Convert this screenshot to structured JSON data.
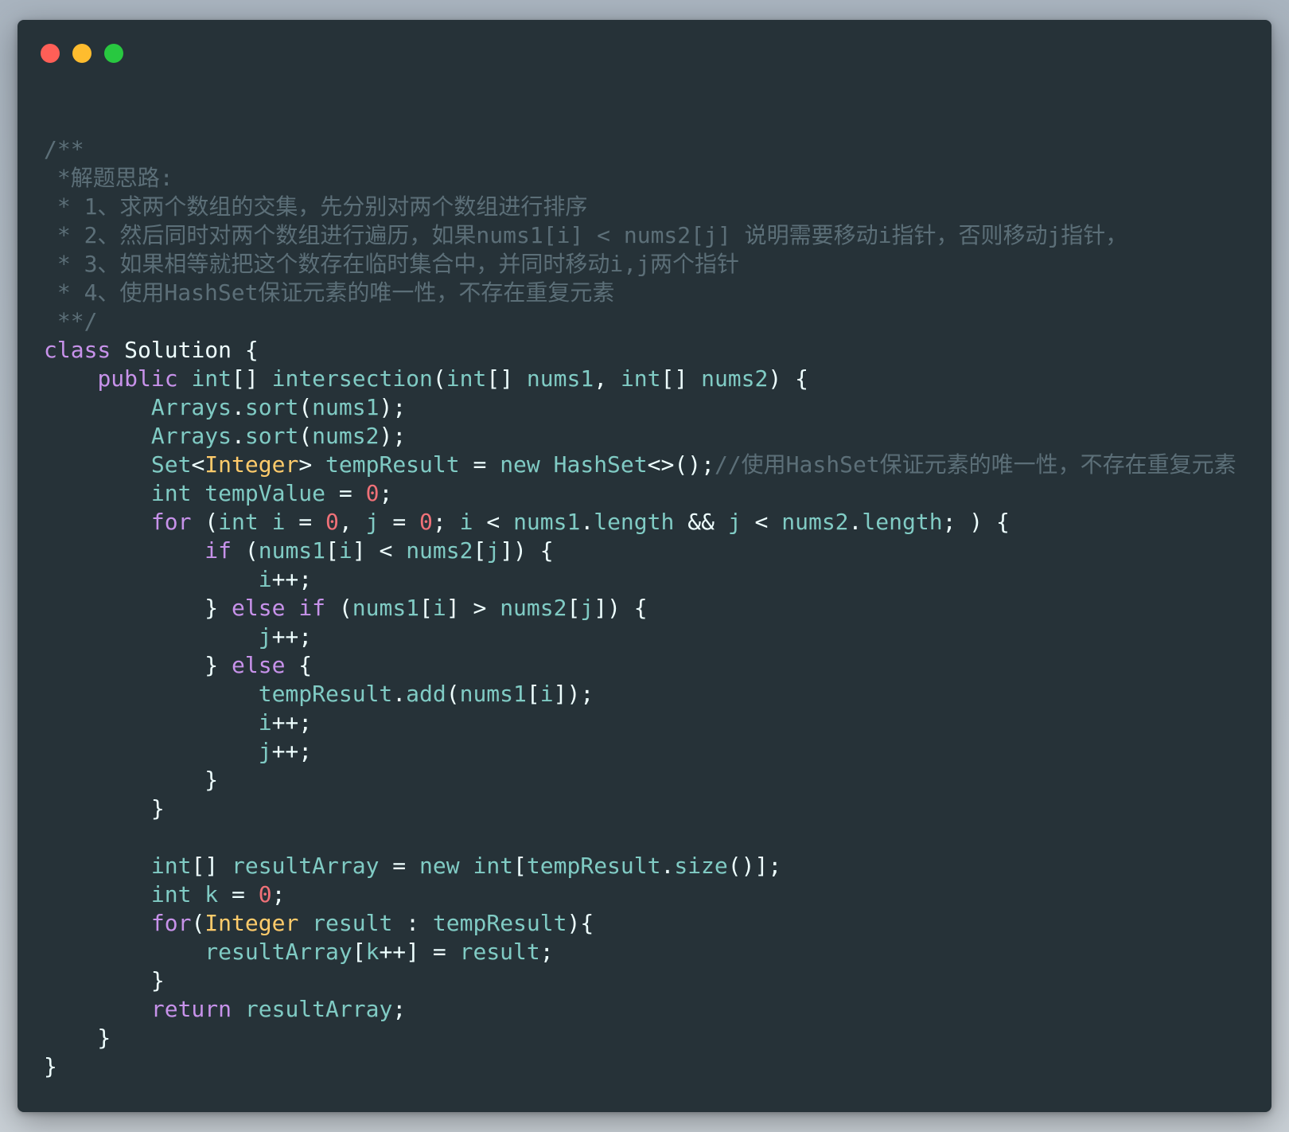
{
  "window": {
    "traffic_lights": [
      {
        "name": "close",
        "color": "#ff5f57"
      },
      {
        "name": "minimize",
        "color": "#febc2e"
      },
      {
        "name": "maximize",
        "color": "#28c840"
      }
    ]
  },
  "colors": {
    "background": "#263238",
    "comment": "#5c6f78",
    "keyword": "#c792ea",
    "identifier": "#80cbc4",
    "number": "#f07178",
    "class": "#ffcb6b",
    "plain": "#eeffff"
  },
  "code": {
    "language": "java",
    "lines": [
      [
        [
          "comment",
          "/**"
        ]
      ],
      [
        [
          "comment",
          " *解题思路:"
        ]
      ],
      [
        [
          "comment",
          " * 1、求两个数组的交集，先分别对两个数组进行排序"
        ]
      ],
      [
        [
          "comment",
          " * 2、然后同时对两个数组进行遍历，如果nums1[i] < nums2[j] 说明需要移动i指针，否则移动j指针，"
        ]
      ],
      [
        [
          "comment",
          " * 3、如果相等就把这个数存在临时集合中，并同时移动i,j两个指针"
        ]
      ],
      [
        [
          "comment",
          " * 4、使用HashSet保证元素的唯一性，不存在重复元素"
        ]
      ],
      [
        [
          "comment",
          " **/"
        ]
      ],
      [
        [
          "keyword",
          "class"
        ],
        [
          "plain",
          " Solution {"
        ]
      ],
      [
        [
          "plain",
          "    "
        ],
        [
          "keyword",
          "public"
        ],
        [
          "plain",
          " "
        ],
        [
          "type",
          "int"
        ],
        [
          "plain",
          "[] "
        ],
        [
          "ident",
          "intersection"
        ],
        [
          "plain",
          "("
        ],
        [
          "type",
          "int"
        ],
        [
          "plain",
          "[] "
        ],
        [
          "ident",
          "nums1"
        ],
        [
          "plain",
          ", "
        ],
        [
          "type",
          "int"
        ],
        [
          "plain",
          "[] "
        ],
        [
          "ident",
          "nums2"
        ],
        [
          "plain",
          ") {"
        ]
      ],
      [
        [
          "plain",
          "        "
        ],
        [
          "ident",
          "Arrays"
        ],
        [
          "plain",
          "."
        ],
        [
          "ident",
          "sort"
        ],
        [
          "plain",
          "("
        ],
        [
          "ident",
          "nums1"
        ],
        [
          "plain",
          ");"
        ]
      ],
      [
        [
          "plain",
          "        "
        ],
        [
          "ident",
          "Arrays"
        ],
        [
          "plain",
          "."
        ],
        [
          "ident",
          "sort"
        ],
        [
          "plain",
          "("
        ],
        [
          "ident",
          "nums2"
        ],
        [
          "plain",
          ");"
        ]
      ],
      [
        [
          "plain",
          "        "
        ],
        [
          "ident",
          "Set"
        ],
        [
          "plain",
          "<"
        ],
        [
          "class",
          "Integer"
        ],
        [
          "plain",
          "> "
        ],
        [
          "ident",
          "tempResult"
        ],
        [
          "plain",
          " = "
        ],
        [
          "ident",
          "new"
        ],
        [
          "plain",
          " "
        ],
        [
          "ident",
          "HashSet"
        ],
        [
          "plain",
          "<>();"
        ],
        [
          "comment",
          "//使用HashSet保证元素的唯一性，不存在重复元素"
        ]
      ],
      [
        [
          "plain",
          "        "
        ],
        [
          "type",
          "int"
        ],
        [
          "plain",
          " "
        ],
        [
          "ident",
          "tempValue"
        ],
        [
          "plain",
          " = "
        ],
        [
          "number",
          "0"
        ],
        [
          "plain",
          ";"
        ]
      ],
      [
        [
          "plain",
          "        "
        ],
        [
          "keyword",
          "for"
        ],
        [
          "plain",
          " ("
        ],
        [
          "type",
          "int"
        ],
        [
          "plain",
          " "
        ],
        [
          "ident",
          "i"
        ],
        [
          "plain",
          " = "
        ],
        [
          "number",
          "0"
        ],
        [
          "plain",
          ", "
        ],
        [
          "ident",
          "j"
        ],
        [
          "plain",
          " = "
        ],
        [
          "number",
          "0"
        ],
        [
          "plain",
          "; "
        ],
        [
          "ident",
          "i"
        ],
        [
          "plain",
          " < "
        ],
        [
          "ident",
          "nums1"
        ],
        [
          "plain",
          "."
        ],
        [
          "ident",
          "length"
        ],
        [
          "plain",
          " && "
        ],
        [
          "ident",
          "j"
        ],
        [
          "plain",
          " < "
        ],
        [
          "ident",
          "nums2"
        ],
        [
          "plain",
          "."
        ],
        [
          "ident",
          "length"
        ],
        [
          "plain",
          "; ) {"
        ]
      ],
      [
        [
          "plain",
          "            "
        ],
        [
          "keyword",
          "if"
        ],
        [
          "plain",
          " ("
        ],
        [
          "ident",
          "nums1"
        ],
        [
          "plain",
          "["
        ],
        [
          "ident",
          "i"
        ],
        [
          "plain",
          "] < "
        ],
        [
          "ident",
          "nums2"
        ],
        [
          "plain",
          "["
        ],
        [
          "ident",
          "j"
        ],
        [
          "plain",
          "]) {"
        ]
      ],
      [
        [
          "plain",
          "                "
        ],
        [
          "ident",
          "i"
        ],
        [
          "plain",
          "++;"
        ]
      ],
      [
        [
          "plain",
          "            } "
        ],
        [
          "keyword",
          "else"
        ],
        [
          "plain",
          " "
        ],
        [
          "keyword",
          "if"
        ],
        [
          "plain",
          " ("
        ],
        [
          "ident",
          "nums1"
        ],
        [
          "plain",
          "["
        ],
        [
          "ident",
          "i"
        ],
        [
          "plain",
          "] > "
        ],
        [
          "ident",
          "nums2"
        ],
        [
          "plain",
          "["
        ],
        [
          "ident",
          "j"
        ],
        [
          "plain",
          "]) {"
        ]
      ],
      [
        [
          "plain",
          "                "
        ],
        [
          "ident",
          "j"
        ],
        [
          "plain",
          "++;"
        ]
      ],
      [
        [
          "plain",
          "            } "
        ],
        [
          "keyword",
          "else"
        ],
        [
          "plain",
          " {"
        ]
      ],
      [
        [
          "plain",
          "                "
        ],
        [
          "ident",
          "tempResult"
        ],
        [
          "plain",
          "."
        ],
        [
          "ident",
          "add"
        ],
        [
          "plain",
          "("
        ],
        [
          "ident",
          "nums1"
        ],
        [
          "plain",
          "["
        ],
        [
          "ident",
          "i"
        ],
        [
          "plain",
          "]);"
        ]
      ],
      [
        [
          "plain",
          "                "
        ],
        [
          "ident",
          "i"
        ],
        [
          "plain",
          "++;"
        ]
      ],
      [
        [
          "plain",
          "                "
        ],
        [
          "ident",
          "j"
        ],
        [
          "plain",
          "++;"
        ]
      ],
      [
        [
          "plain",
          "            }"
        ]
      ],
      [
        [
          "plain",
          "        }"
        ]
      ],
      [],
      [
        [
          "plain",
          "        "
        ],
        [
          "type",
          "int"
        ],
        [
          "plain",
          "[] "
        ],
        [
          "ident",
          "resultArray"
        ],
        [
          "plain",
          " = "
        ],
        [
          "ident",
          "new"
        ],
        [
          "plain",
          " "
        ],
        [
          "type",
          "int"
        ],
        [
          "plain",
          "["
        ],
        [
          "ident",
          "tempResult"
        ],
        [
          "plain",
          "."
        ],
        [
          "ident",
          "size"
        ],
        [
          "plain",
          "()];"
        ]
      ],
      [
        [
          "plain",
          "        "
        ],
        [
          "type",
          "int"
        ],
        [
          "plain",
          " "
        ],
        [
          "ident",
          "k"
        ],
        [
          "plain",
          " = "
        ],
        [
          "number",
          "0"
        ],
        [
          "plain",
          ";"
        ]
      ],
      [
        [
          "plain",
          "        "
        ],
        [
          "keyword",
          "for"
        ],
        [
          "plain",
          "("
        ],
        [
          "class",
          "Integer"
        ],
        [
          "plain",
          " "
        ],
        [
          "ident",
          "result"
        ],
        [
          "plain",
          " : "
        ],
        [
          "ident",
          "tempResult"
        ],
        [
          "plain",
          "){"
        ]
      ],
      [
        [
          "plain",
          "            "
        ],
        [
          "ident",
          "resultArray"
        ],
        [
          "plain",
          "["
        ],
        [
          "ident",
          "k"
        ],
        [
          "plain",
          "++] = "
        ],
        [
          "ident",
          "result"
        ],
        [
          "plain",
          ";"
        ]
      ],
      [
        [
          "plain",
          "        }"
        ]
      ],
      [
        [
          "plain",
          "        "
        ],
        [
          "keyword",
          "return"
        ],
        [
          "plain",
          " "
        ],
        [
          "ident",
          "resultArray"
        ],
        [
          "plain",
          ";"
        ]
      ],
      [
        [
          "plain",
          "    }"
        ]
      ],
      [
        [
          "plain",
          "}"
        ]
      ]
    ]
  }
}
